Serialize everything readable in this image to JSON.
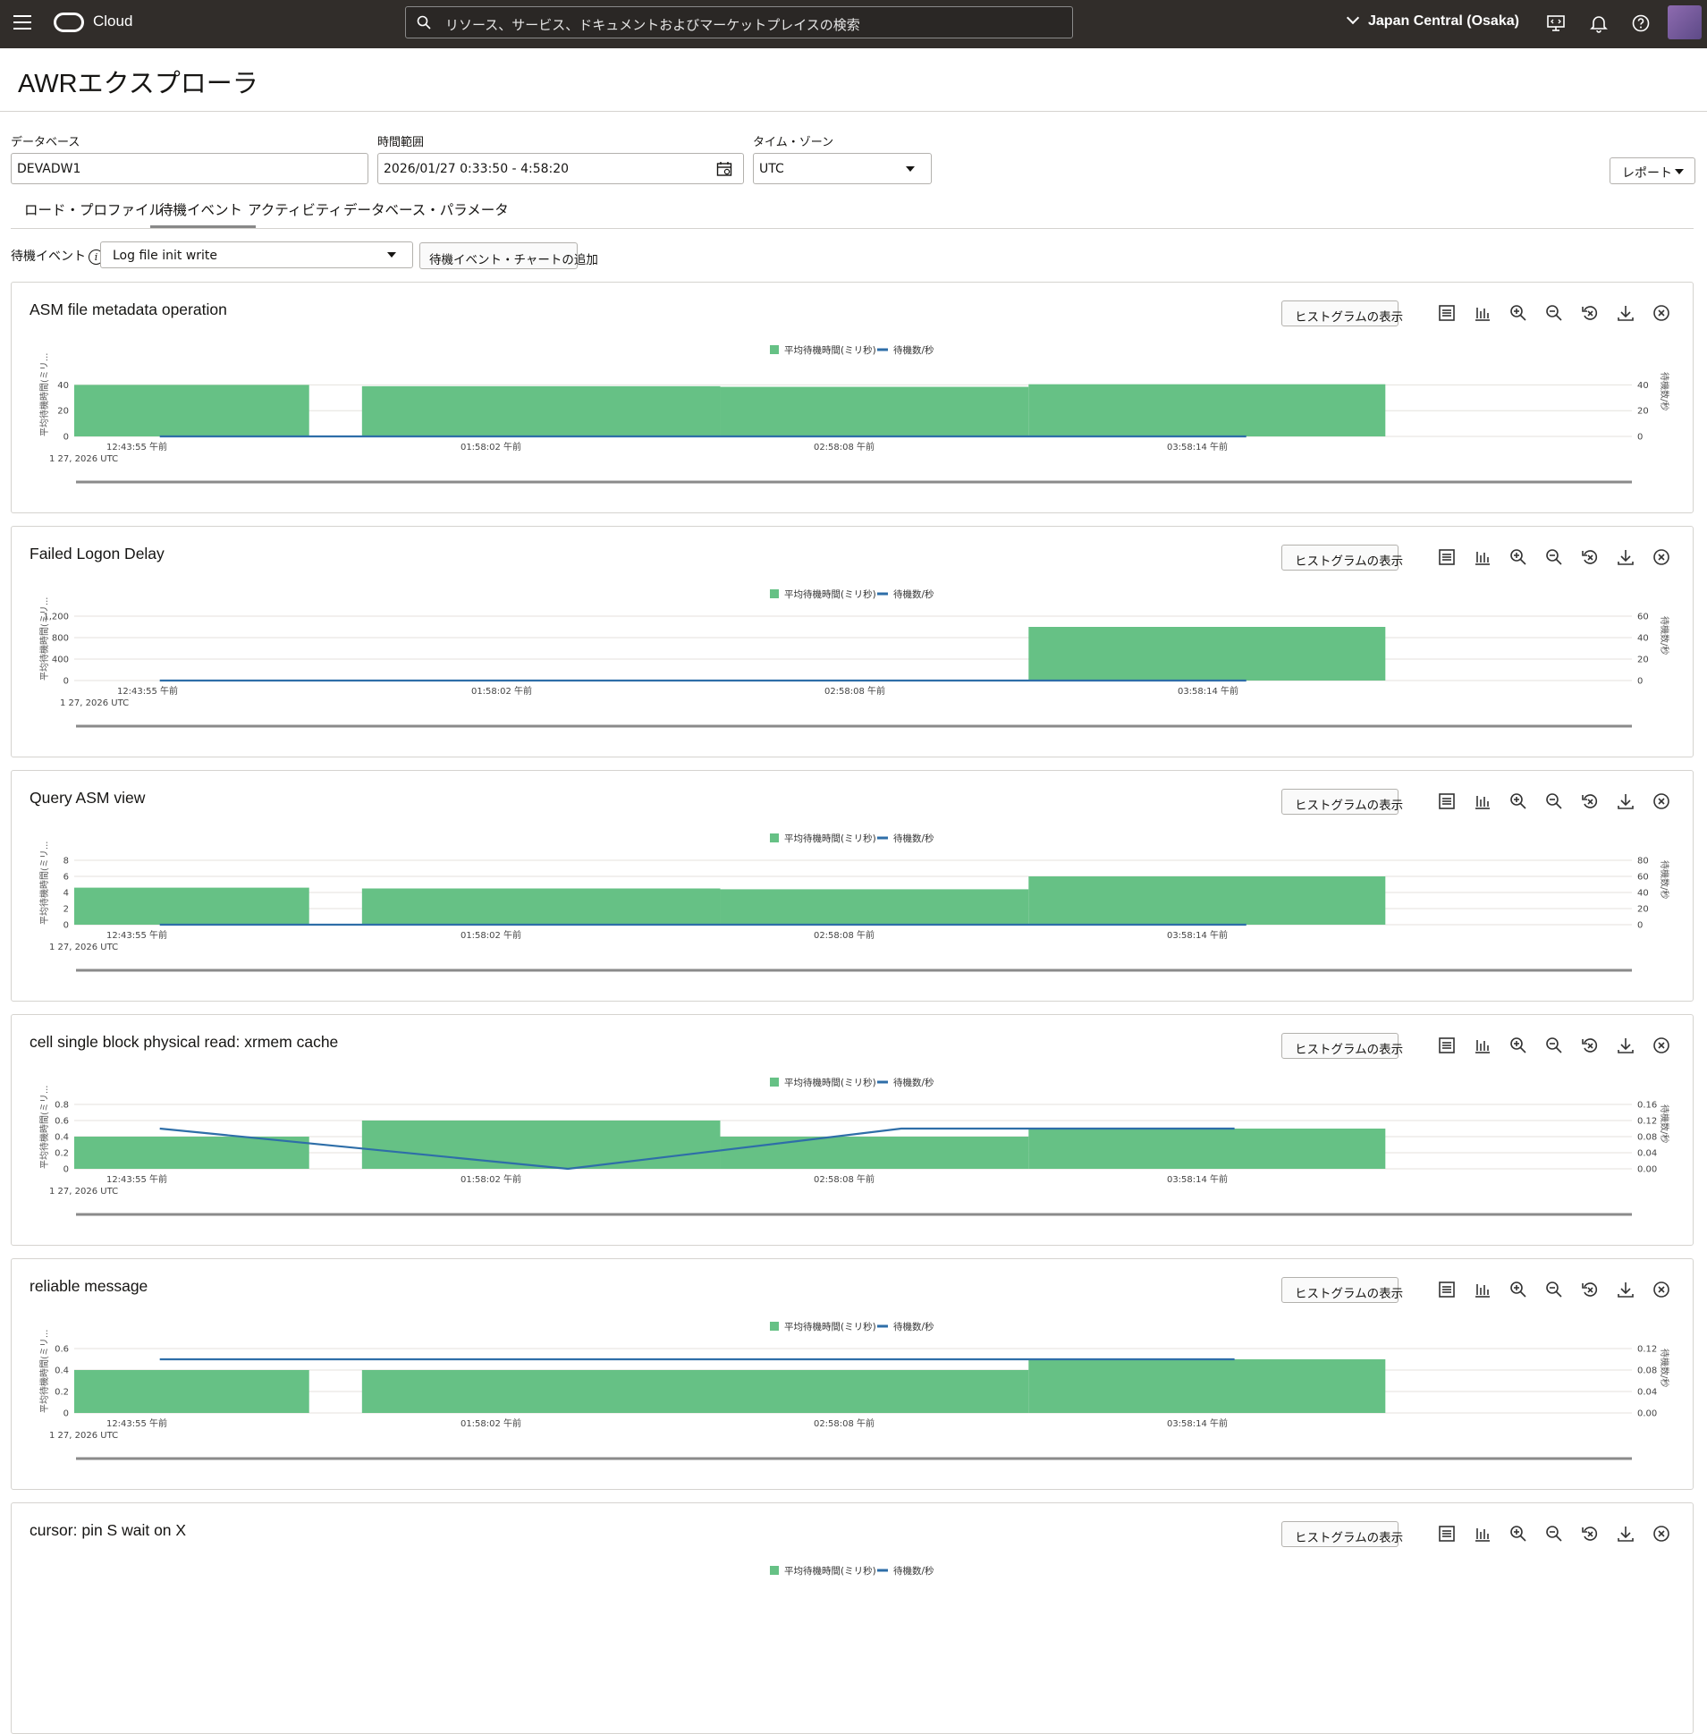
{
  "topbar": {
    "brand": "Cloud",
    "search_placeholder": "リソース、サービス、ドキュメントおよびマーケットプレイスの検索",
    "region": "Japan Central (Osaka)"
  },
  "page": {
    "title": "AWRエクスプローラ"
  },
  "filters": {
    "database_label": "データベース",
    "database_value": "DEVADW1",
    "time_label": "時間範囲",
    "time_value": "2026/01/27 0:33:50 - 4:58:20",
    "tz_label": "タイム・ゾーン",
    "tz_value": "UTC",
    "report_label": "レポート"
  },
  "tabs": [
    "ロード・プロファイル",
    "待機イベント",
    "アクティビティ",
    "データベース・パラメータ"
  ],
  "wait_event": {
    "label": "待機イベント",
    "selected": "Log file init write",
    "add_button": "待機イベント・チャートの追加"
  },
  "panel_common": {
    "histogram_button": "ヒストグラムの表示",
    "legend_bar": "平均待機時間(ミリ秒)",
    "legend_line": "待機数/秒",
    "y_left_label": "平均待機時間(ミリ...",
    "y_right_label": "待機数/秒",
    "x_ticks": [
      "12:43:55 午前",
      "01:58:02 午前",
      "02:58:08 午前",
      "03:58:14 午前"
    ],
    "date_label": "1 27, 2026 UTC",
    "bar_color": "#66c185",
    "line_color": "#2e6ea8"
  },
  "chart_data": [
    {
      "type": "bar",
      "title": "ASM file metadata operation",
      "left_ticks": [
        "0",
        "20",
        "40"
      ],
      "left_max": 50,
      "right_ticks": [
        "0",
        "20",
        "40"
      ],
      "right_max": 50,
      "bars": [
        [
          0.0,
          0.16,
          40
        ],
        [
          0.196,
          0.44,
          39
        ],
        [
          0.44,
          0.65,
          38.5
        ],
        [
          0.65,
          0.893,
          40.5
        ]
      ],
      "line": [
        [
          0.04,
          0
        ],
        [
          0.78,
          0
        ]
      ]
    },
    {
      "type": "bar",
      "title": "Failed Logon Delay",
      "left_ticks": [
        "0",
        "400",
        "800",
        "1,200"
      ],
      "left_max": 1200,
      "right_ticks": [
        "0",
        "20",
        "40",
        "60"
      ],
      "right_max": 60,
      "bars": [
        [
          0.65,
          0.893,
          1000
        ]
      ],
      "line": [
        [
          0.04,
          0
        ],
        [
          0.78,
          0
        ]
      ]
    },
    {
      "type": "bar",
      "title": "Query ASM view",
      "left_ticks": [
        "0",
        "2",
        "4",
        "6",
        "8"
      ],
      "left_max": 8,
      "right_ticks": [
        "0",
        "20",
        "40",
        "60",
        "80"
      ],
      "right_max": 80,
      "bars": [
        [
          0.0,
          0.16,
          4.6
        ],
        [
          0.196,
          0.44,
          4.5
        ],
        [
          0.44,
          0.65,
          4.4
        ],
        [
          0.65,
          0.893,
          6.0
        ]
      ],
      "line": [
        [
          0.04,
          0
        ],
        [
          0.78,
          0
        ]
      ]
    },
    {
      "type": "bar",
      "title": "cell single block physical read: xrmem cache",
      "left_ticks": [
        "0",
        "0.2",
        "0.4",
        "0.6",
        "0.8"
      ],
      "left_max": 0.8,
      "right_ticks": [
        "0.00",
        "0.04",
        "0.08",
        "0.12",
        "0.16"
      ],
      "right_max": 0.16,
      "bars": [
        [
          0.0,
          0.16,
          0.4
        ],
        [
          0.196,
          0.44,
          0.6
        ],
        [
          0.44,
          0.65,
          0.4
        ],
        [
          0.65,
          0.893,
          0.5
        ]
      ],
      "line": [
        [
          0.04,
          0.1
        ],
        [
          0.318,
          0.0
        ],
        [
          0.545,
          0.1
        ],
        [
          0.772,
          0.1
        ]
      ]
    },
    {
      "type": "bar",
      "title": "reliable message",
      "left_ticks": [
        "0",
        "0.2",
        "0.4",
        "0.6"
      ],
      "left_max": 0.6,
      "right_ticks": [
        "0.00",
        "0.04",
        "0.08",
        "0.12"
      ],
      "right_max": 0.12,
      "bars": [
        [
          0.0,
          0.16,
          0.4
        ],
        [
          0.196,
          0.65,
          0.4
        ],
        [
          0.65,
          0.893,
          0.5
        ]
      ],
      "line": [
        [
          0.04,
          0.1
        ],
        [
          0.772,
          0.1
        ]
      ]
    },
    {
      "type": "bar",
      "title": "cursor: pin S wait on X",
      "left_ticks": [],
      "left_max": 1,
      "right_ticks": [],
      "right_max": 1,
      "bars": [],
      "line": []
    }
  ]
}
